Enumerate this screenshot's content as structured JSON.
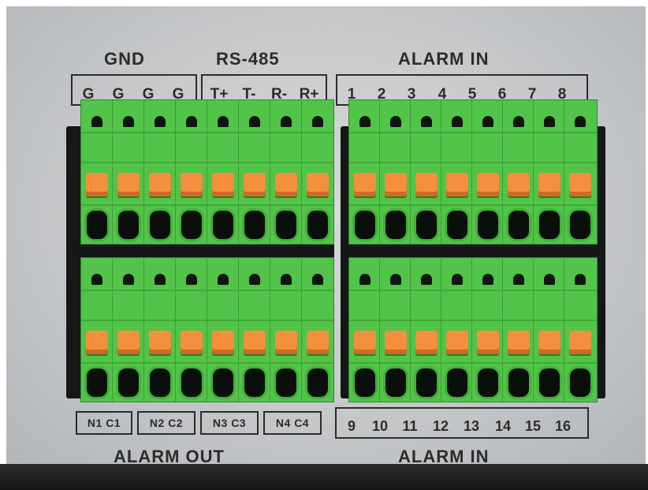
{
  "top_labels": {
    "gnd": "GND",
    "rs485": "RS-485",
    "alarm_in_top": "ALARM IN"
  },
  "top_pins": {
    "gnd": [
      "G",
      "G",
      "G",
      "G"
    ],
    "rs485": [
      "T+",
      "T-",
      "R-",
      "R+"
    ],
    "alarm_in": [
      "1",
      "2",
      "3",
      "4",
      "5",
      "6",
      "7",
      "8"
    ]
  },
  "bottom_pins": {
    "alarm_out": [
      "N1 C1",
      "N2 C2",
      "N3 C3",
      "N4 C4"
    ],
    "alarm_in": [
      "9",
      "10",
      "11",
      "12",
      "13",
      "14",
      "15",
      "16"
    ]
  },
  "bottom_labels": {
    "alarm_out": "ALARM OUT",
    "alarm_in_bottom": "ALARM IN"
  },
  "colors": {
    "terminal_green": "#52c449",
    "lever_orange": "#f38f3d",
    "panel_gray": "#c6c8ca"
  }
}
